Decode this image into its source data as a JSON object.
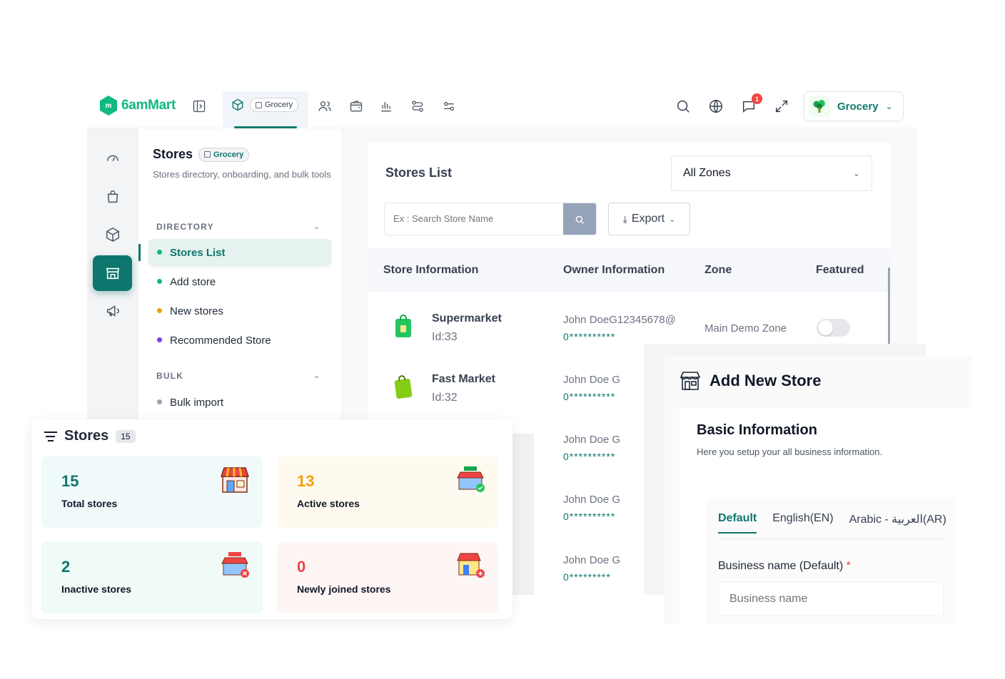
{
  "brand": {
    "name": "6amMart"
  },
  "topbar": {
    "module_chip": "Grocery",
    "notification_count": "1",
    "module_select": "Grocery"
  },
  "sidebar": {
    "title": "Stores",
    "title_chip": "Grocery",
    "description": "Stores directory, onboarding, and bulk tools",
    "sections": [
      {
        "heading": "DIRECTORY",
        "items": [
          {
            "label": "Stores List",
            "dot": "#10b981",
            "active": true
          },
          {
            "label": "Add store",
            "dot": "#10b981"
          },
          {
            "label": "New stores",
            "dot": "#f59e0b"
          },
          {
            "label": "Recommended Store",
            "dot": "#7c3aed"
          }
        ]
      },
      {
        "heading": "BULK",
        "items": [
          {
            "label": "Bulk import",
            "dot": "#9ca3af"
          }
        ]
      }
    ]
  },
  "stores_list": {
    "title": "Stores List",
    "zone_filter": "All Zones",
    "search_placeholder": "Ex : Search Store Name",
    "export_label": "Export",
    "columns": [
      "Store Information",
      "Owner Information",
      "Zone",
      "Featured"
    ],
    "rows": [
      {
        "name": "Supermarket",
        "id": "Id:33",
        "owner": "John DoeG12345678@",
        "phone": "0**********",
        "zone": "Main Demo Zone",
        "featured": false
      },
      {
        "name": "Fast Market",
        "id": "Id:32",
        "owner": "John Doe G",
        "phone": "0**********",
        "zone": "",
        "featured": null
      },
      {
        "name": "",
        "id": "",
        "owner": "John Doe G",
        "phone": "0**********",
        "zone": "",
        "featured": null
      },
      {
        "name": "",
        "id": "",
        "owner": "John Doe G",
        "phone": "0**********",
        "zone": "",
        "featured": null
      },
      {
        "name": "",
        "id": "",
        "owner": "John Doe G",
        "phone": "0*********",
        "zone": "",
        "featured": null
      }
    ]
  },
  "stores_summary": {
    "title": "Stores",
    "count": "15",
    "stats": [
      {
        "value": "15",
        "label": "Total stores",
        "color": "#0f766e",
        "bg": "#f0fafb"
      },
      {
        "value": "13",
        "label": "Active stores",
        "color": "#f59e0b",
        "bg": "#fefaf0"
      },
      {
        "value": "2",
        "label": "Inactive stores",
        "color": "#0f766e",
        "bg": "#f0faf6"
      },
      {
        "value": "0",
        "label": "Newly joined stores",
        "color": "#ef4444",
        "bg": "#fef5f5"
      }
    ]
  },
  "add_store": {
    "title": "Add New Store",
    "section_title": "Basic Information",
    "section_desc": "Here you setup your all business information.",
    "tabs": [
      "Default",
      "English(EN)",
      "Arabic - العربية(AR)"
    ],
    "field_label": "Business name (Default)",
    "required_mark": "*",
    "field_placeholder": "Business name"
  }
}
